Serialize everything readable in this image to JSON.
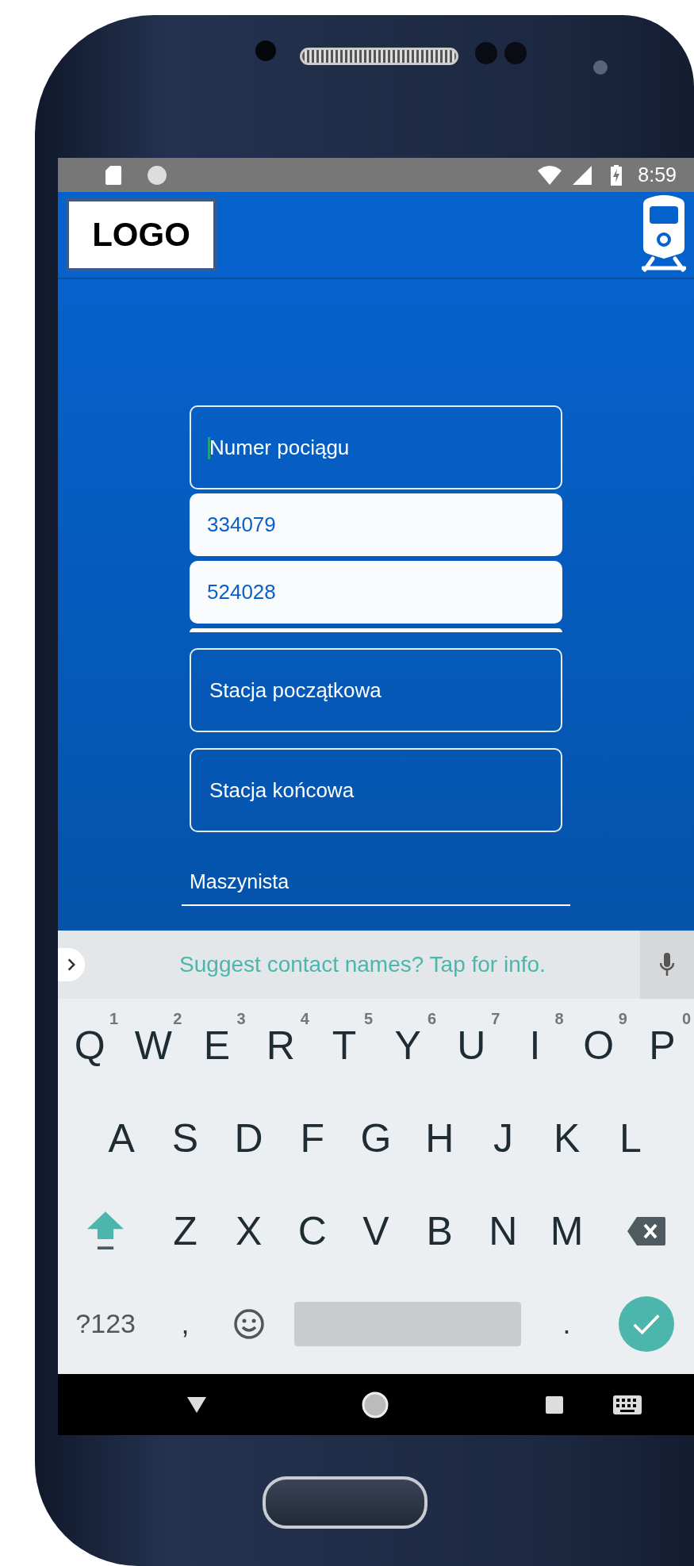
{
  "status_bar": {
    "time": "8:59"
  },
  "app_bar": {
    "logo": "LOGO"
  },
  "form": {
    "train_number": {
      "placeholder": "Numer pociągu",
      "focused": true
    },
    "suggestions": [
      {
        "value": "334079"
      },
      {
        "value": "524028"
      }
    ],
    "start_station": {
      "placeholder": "Stacja początkowa"
    },
    "end_station": {
      "placeholder": "Stacja końcowa"
    },
    "driver": {
      "placeholder": "Maszynista"
    }
  },
  "keyboard": {
    "suggestion": "Suggest contact names? Tap for info.",
    "row_1": [
      {
        "label": "Q",
        "hint": "1"
      },
      {
        "label": "W",
        "hint": "2"
      },
      {
        "label": "E",
        "hint": "3"
      },
      {
        "label": "R",
        "hint": "4"
      },
      {
        "label": "T",
        "hint": "5"
      },
      {
        "label": "Y",
        "hint": "6"
      },
      {
        "label": "U",
        "hint": "7"
      },
      {
        "label": "I",
        "hint": "8"
      },
      {
        "label": "O",
        "hint": "9"
      },
      {
        "label": "P",
        "hint": "0"
      }
    ],
    "row_2": [
      "A",
      "S",
      "D",
      "F",
      "G",
      "H",
      "J",
      "K",
      "L"
    ],
    "row_3": [
      "Z",
      "X",
      "C",
      "V",
      "B",
      "N",
      "M"
    ],
    "symbols_key": "?123",
    "comma_key": ",",
    "period_key": "."
  }
}
